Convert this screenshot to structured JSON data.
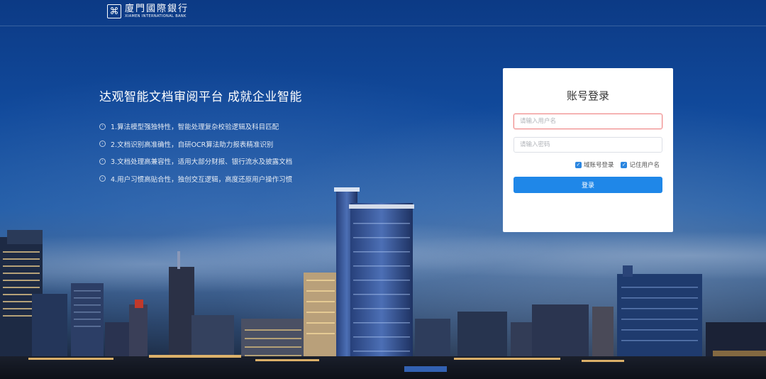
{
  "brand": {
    "mark": "⌘",
    "name_cn": "廈門國際銀行",
    "name_en": "XIAMEN INTERNATIONAL BANK"
  },
  "hero": {
    "headline": "达观智能文档审阅平台 成就企业智能",
    "features": [
      {
        "bullet": "›",
        "text": "1.算法模型强独特性，智能处理复杂校验逻辑及科目匹配"
      },
      {
        "bullet": "›",
        "text": "2.文档识别高准确性，自研OCR算法助力报表精准识别"
      },
      {
        "bullet": "›",
        "text": "3.文档处理高兼容性，适用大部分财报、银行流水及披露文档"
      },
      {
        "bullet": "›",
        "text": "4.用户习惯高贴合性，独创交互逻辑，高度还原用户操作习惯"
      }
    ]
  },
  "login": {
    "title": "账号登录",
    "username_placeholder": "请输入用户名",
    "username_value": "",
    "password_placeholder": "请输入密码",
    "password_value": "",
    "domain_login_label": "域账号登录",
    "domain_login_checked": true,
    "remember_label": "记住用户名",
    "remember_checked": true,
    "submit_label": "登录",
    "check_glyph": "✓"
  },
  "colors": {
    "primary": "#1f87e8",
    "checkbox": "#2b86e0",
    "input_error_border": "#f08a8a",
    "sky_top": "#0c3a85"
  }
}
